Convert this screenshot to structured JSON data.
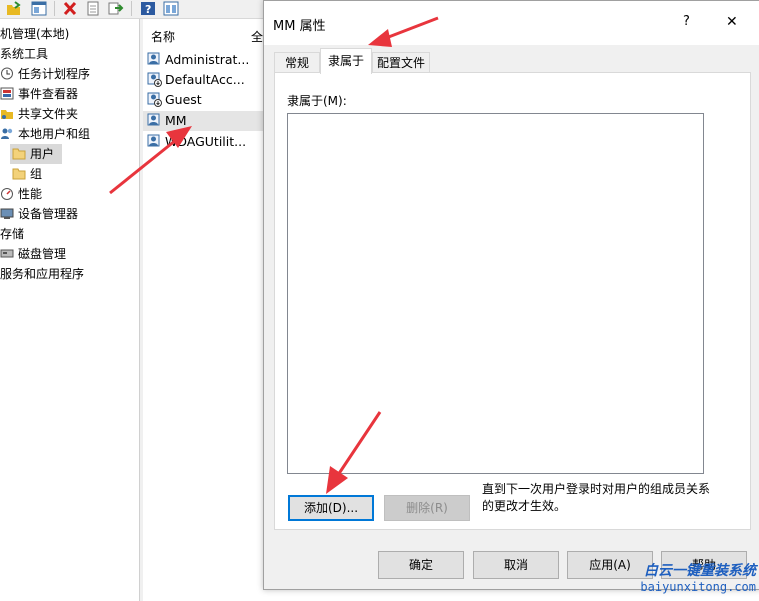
{
  "toolbar": {
    "icons": [
      "open-folder-icon",
      "properties-icon",
      "delete-icon",
      "doc-icon",
      "export-icon",
      "help-icon",
      "view-icon"
    ]
  },
  "tree": {
    "items": [
      {
        "label": "机管理(本地)",
        "icon": "computer-icon"
      },
      {
        "label": "系统工具",
        "icon": "tools-icon"
      },
      {
        "label": "任务计划程序",
        "icon": "clock-icon"
      },
      {
        "label": "事件查看器",
        "icon": "event-viewer-icon"
      },
      {
        "label": "共享文件夹",
        "icon": "shared-folder-icon"
      },
      {
        "label": "本地用户和组",
        "icon": "users-icon"
      },
      {
        "label": "用户",
        "icon": "folder-icon"
      },
      {
        "label": "组",
        "icon": "folder-icon"
      },
      {
        "label": "性能",
        "icon": "performance-icon"
      },
      {
        "label": "设备管理器",
        "icon": "device-manager-icon"
      },
      {
        "label": "存储",
        "icon": ""
      },
      {
        "label": "磁盘管理",
        "icon": "disk-icon"
      },
      {
        "label": "服务和应用程序",
        "icon": ""
      }
    ]
  },
  "list": {
    "col_name": "名称",
    "col_full": "全",
    "users": [
      "Administrat...",
      "DefaultAcc...",
      "Guest",
      "MM",
      "WDAGUtilit..."
    ]
  },
  "dialog": {
    "title": "MM 属性",
    "help_glyph": "?",
    "close_glyph": "✕",
    "tabs": [
      "常规",
      "隶属于",
      "配置文件"
    ],
    "member_of_label": "隶属于(M):",
    "add_button": "添加(D)...",
    "remove_button": "删除(R)",
    "note": "直到下一次用户登录时对用户的组成员关系的更改才生效。",
    "ok": "确定",
    "cancel": "取消",
    "apply": "应用(A)",
    "help": "帮助"
  },
  "watermark": {
    "line1": "白云一键重装系统",
    "line2": "baiyunxitong.com"
  },
  "colors": {
    "annotation_arrow": "#e8353d",
    "accent": "#0078d7"
  }
}
